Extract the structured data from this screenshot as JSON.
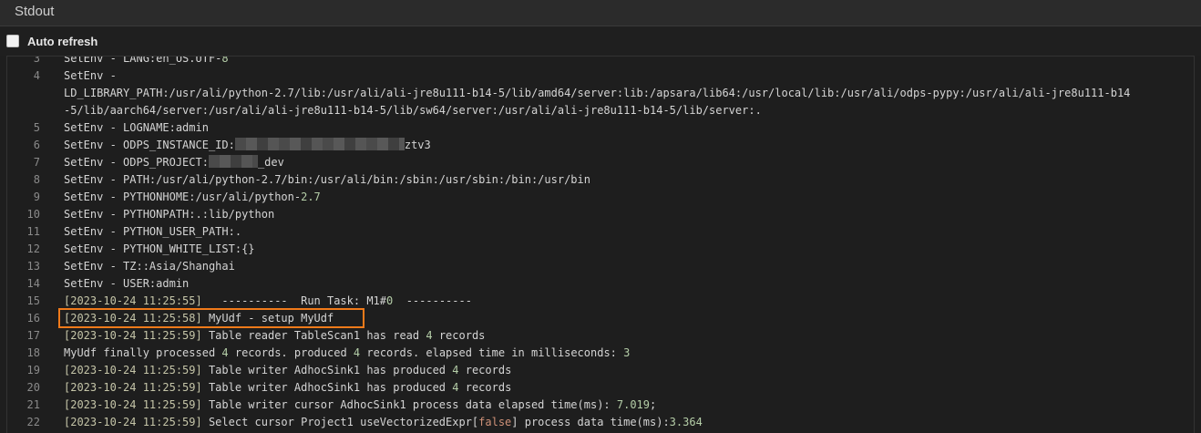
{
  "header": {
    "title": "Stdout"
  },
  "toolbar": {
    "auto_refresh_label": "Auto refresh",
    "auto_refresh_checked": false
  },
  "colors": {
    "highlight": "#f07a1a"
  },
  "log_lines": [
    {
      "n": "3",
      "text": "SetEnv - LANG:en_US.UTF-8"
    },
    {
      "n": "4",
      "text": "SetEnv -"
    },
    {
      "n": "",
      "text": "LD_LIBRARY_PATH:/usr/ali/python-2.7/lib:/usr/ali/ali-jre8u111-b14-5/lib/amd64/server:lib:/apsara/lib64:/usr/local/lib:/usr/ali/odps-pypy:/usr/ali/ali-jre8u111-b14"
    },
    {
      "n": "",
      "text": "-5/lib/aarch64/server:/usr/ali/ali-jre8u111-b14-5/lib/sw64/server:/usr/ali/ali-jre8u111-b14-5/lib/server:."
    },
    {
      "n": "5",
      "text": "SetEnv - LOGNAME:admin"
    },
    {
      "n": "6",
      "pre": "SetEnv - ODPS_INSTANCE_ID:",
      "post": "ztv3"
    },
    {
      "n": "7",
      "pre": "SetEnv - ODPS_PROJECT:",
      "post": "_dev"
    },
    {
      "n": "8",
      "text": "SetEnv - PATH:/usr/ali/python-2.7/bin:/usr/ali/bin:/sbin:/usr/sbin:/bin:/usr/bin"
    },
    {
      "n": "9",
      "text": "SetEnv - PYTHONHOME:/usr/ali/python-2.7"
    },
    {
      "n": "10",
      "text": "SetEnv - PYTHONPATH:.:lib/python"
    },
    {
      "n": "11",
      "text": "SetEnv - PYTHON_USER_PATH:."
    },
    {
      "n": "12",
      "text": "SetEnv - PYTHON_WHITE_LIST:{}"
    },
    {
      "n": "13",
      "text": "SetEnv - TZ::Asia/Shanghai"
    },
    {
      "n": "14",
      "text": "SetEnv - USER:admin"
    },
    {
      "n": "15",
      "ts": "[2023-10-24 11:25:55]",
      "text": "   ----------  Run Task: M1#0  ----------"
    },
    {
      "n": "16",
      "ts": "[2023-10-24 11:25:58]",
      "text": " MyUdf - setup MyUdf"
    },
    {
      "n": "17",
      "ts": "[2023-10-24 11:25:59]",
      "text": " Table reader TableScan1 has read 4 records"
    },
    {
      "n": "18",
      "text": "MyUdf finally processed 4 records. produced 4 records. elapsed time in milliseconds: 3"
    },
    {
      "n": "19",
      "ts": "[2023-10-24 11:25:59]",
      "text": " Table writer AdhocSink1 has produced 4 records"
    },
    {
      "n": "20",
      "ts": "[2023-10-24 11:25:59]",
      "text": " Table writer AdhocSink1 has produced 4 records"
    },
    {
      "n": "21",
      "ts": "[2023-10-24 11:25:59]",
      "text": " Table writer cursor AdhocSink1 process data elapsed time(ms): 7.019;"
    },
    {
      "n": "22",
      "ts": "[2023-10-24 11:25:59]",
      "text": " Select cursor Project1 useVectorizedExpr[",
      "bool": "false",
      "post2": "] process data time(ms):3.364"
    }
  ]
}
